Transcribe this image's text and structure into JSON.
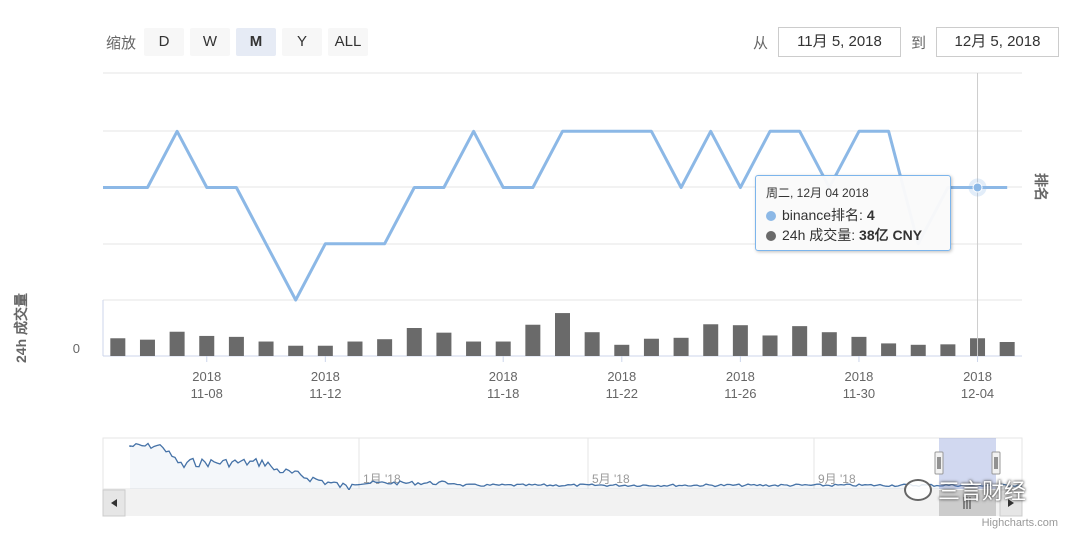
{
  "zoom": {
    "label": "缩放",
    "buttons": [
      {
        "label": "D",
        "selected": false
      },
      {
        "label": "W",
        "selected": false
      },
      {
        "label": "M",
        "selected": true
      },
      {
        "label": "Y",
        "selected": false
      },
      {
        "label": "ALL",
        "selected": false
      }
    ]
  },
  "range": {
    "from_label": "从",
    "from_value": "11月 5, 2018",
    "to_label": "到",
    "to_value": "12月 5, 2018"
  },
  "tooltip": {
    "date": "周二, 12月 04 2018",
    "rows": [
      {
        "label": "binance排名: ",
        "value": "4",
        "color": "#8cb8e6"
      },
      {
        "label": "24h 成交量: ",
        "value": "38亿 CNY",
        "color": "#6a6a6a"
      }
    ]
  },
  "credits": "Highcharts.com",
  "watermark": "三言财经",
  "chart_data": {
    "type": "line",
    "x": [
      "2018-11-05",
      "2018-11-06",
      "2018-11-07",
      "2018-11-08",
      "2018-11-09",
      "2018-11-10",
      "2018-11-11",
      "2018-11-12",
      "2018-11-13",
      "2018-11-14",
      "2018-11-15",
      "2018-11-16",
      "2018-11-17",
      "2018-11-18",
      "2018-11-19",
      "2018-11-20",
      "2018-11-21",
      "2018-11-22",
      "2018-11-23",
      "2018-11-24",
      "2018-11-25",
      "2018-11-26",
      "2018-11-27",
      "2018-11-28",
      "2018-11-29",
      "2018-11-30",
      "2018-12-01",
      "2018-12-02",
      "2018-12-03",
      "2018-12-04",
      "2018-12-05"
    ],
    "series": [
      {
        "name": "binance排名",
        "axis": "排名",
        "color": "#8cb8e6",
        "values": [
          4,
          4,
          3,
          4,
          4,
          5,
          6,
          5,
          5,
          5,
          4,
          4,
          3,
          4,
          4,
          3,
          3,
          3,
          3,
          4,
          3,
          4,
          3,
          3,
          4,
          3,
          3,
          5,
          4,
          4,
          4
        ]
      },
      {
        "name": "24h 成交量",
        "axis": "24h 成交量",
        "unit": "亿 CNY",
        "color": "#6a6a6a",
        "values": [
          38,
          35,
          52,
          43,
          41,
          31,
          22,
          22,
          31,
          36,
          60,
          50,
          31,
          31,
          67,
          92,
          51,
          24,
          37,
          39,
          68,
          66,
          44,
          64,
          51,
          41,
          27,
          24,
          25,
          38,
          30
        ]
      }
    ],
    "y_axes": [
      {
        "title": "排名",
        "side": "right",
        "reversed": true,
        "range": [
          2,
          6
        ]
      },
      {
        "title": "24h 成交量",
        "side": "left",
        "min_label": "0",
        "range": [
          0,
          120
        ]
      }
    ],
    "x_tick_labels": [
      {
        "year": "2018",
        "date": "11-08"
      },
      {
        "year": "2018",
        "date": "11-12"
      },
      {
        "year": "2018",
        "date": "11-18"
      },
      {
        "year": "2018",
        "date": "11-22"
      },
      {
        "year": "2018",
        "date": "11-26"
      },
      {
        "year": "2018",
        "date": "11-30"
      },
      {
        "year": "2018",
        "date": "12-04"
      }
    ],
    "hover": {
      "x": "2018-12-04"
    },
    "navigator": {
      "labels": [
        "1月 '18",
        "5月 '18",
        "9月 '18"
      ],
      "window": [
        "2018-11-05",
        "2018-12-05"
      ]
    }
  }
}
